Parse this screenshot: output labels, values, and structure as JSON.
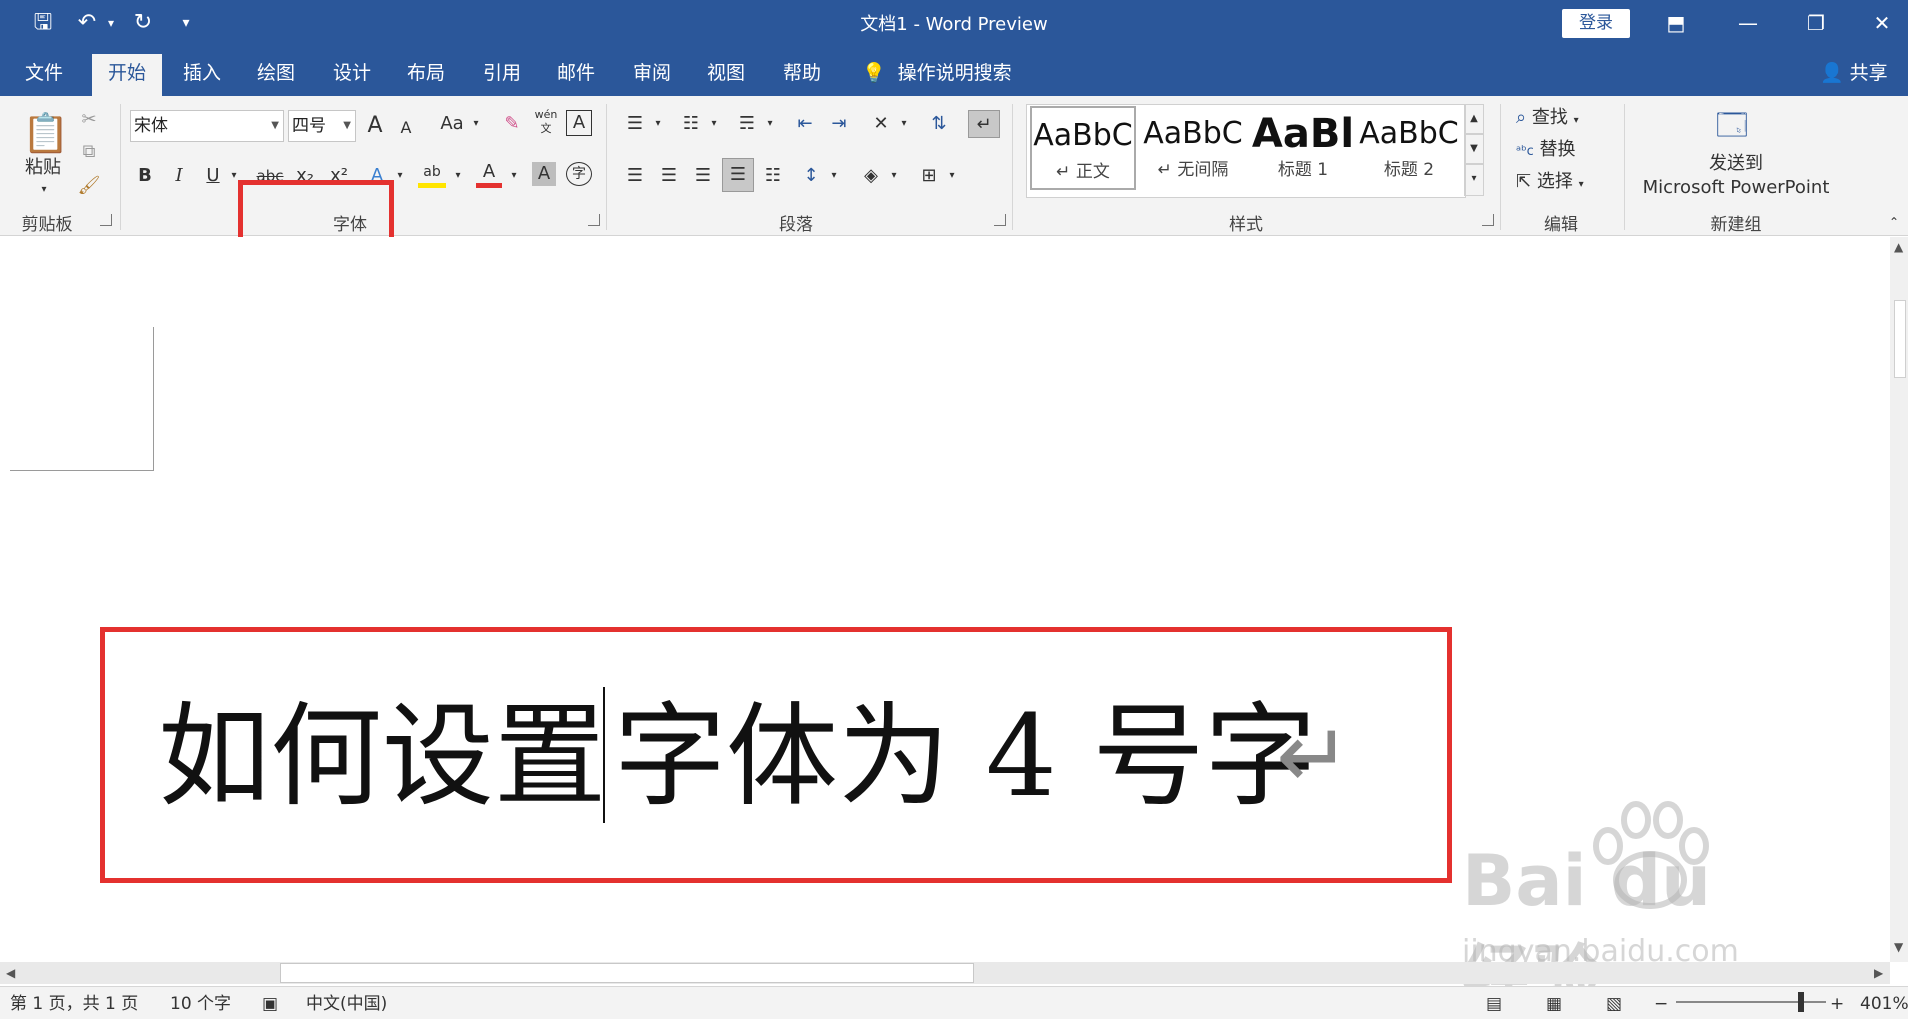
{
  "titlebar": {
    "title": "文档1  -  Word Preview",
    "signin": "登录",
    "qat": {
      "save": "🖫",
      "undo": "↶",
      "redo": "↻",
      "customize": "▾"
    },
    "window": {
      "ribbon_display": "⬒",
      "minimize": "—",
      "restore": "❐",
      "close": "✕"
    }
  },
  "tabs": [
    "文件",
    "开始",
    "插入",
    "绘图",
    "设计",
    "布局",
    "引用",
    "邮件",
    "审阅",
    "视图",
    "帮助"
  ],
  "active_tab": "开始",
  "tell_me": "操作说明搜索",
  "share": "共享",
  "ribbon": {
    "clipboard": {
      "label": "剪贴板",
      "paste": "粘贴"
    },
    "font": {
      "label": "字体",
      "font_name": "宋体",
      "font_size": "四号",
      "grow": "A",
      "shrink": "A",
      "change_case": "Aa",
      "bold": "B",
      "italic": "I",
      "underline": "U",
      "strikethrough": "abc",
      "subscript": "x₂",
      "superscript": "x²",
      "text_effects": "A",
      "highlight": "ab",
      "font_color": "A",
      "char_shading": "A",
      "phonetic": "wén",
      "enclose": "字"
    },
    "paragraph": {
      "label": "段落"
    },
    "styles": {
      "label": "样式",
      "items": [
        {
          "sample": "AaBbC",
          "name": "↵ 正文"
        },
        {
          "sample": "AaBbC",
          "name": "↵ 无间隔"
        },
        {
          "sample": "AaBl",
          "name": "标题 1"
        },
        {
          "sample": "AaBbC",
          "name": "标题 2"
        }
      ]
    },
    "editing": {
      "label": "编辑",
      "find": "查找",
      "replace": "替换",
      "select": "选择"
    },
    "new_group": {
      "label": "新建组",
      "line1": "发送到",
      "line2": "Microsoft PowerPoint"
    }
  },
  "document": {
    "text_before_caret": "如何设置",
    "text_after_caret": "字体为 4 号字",
    "paragraph_mark": "↵"
  },
  "status": {
    "page": "第 1 页，共 1 页",
    "words": "10 个字",
    "language": "中文(中国)",
    "zoom": "401%",
    "zoom_minus": "−",
    "zoom_plus": "+"
  },
  "watermark": {
    "logo": "Bai du 经验",
    "url": "jingyan.baidu.com"
  },
  "colors": {
    "accent": "#2b579a",
    "annotation": "#e4312f"
  }
}
